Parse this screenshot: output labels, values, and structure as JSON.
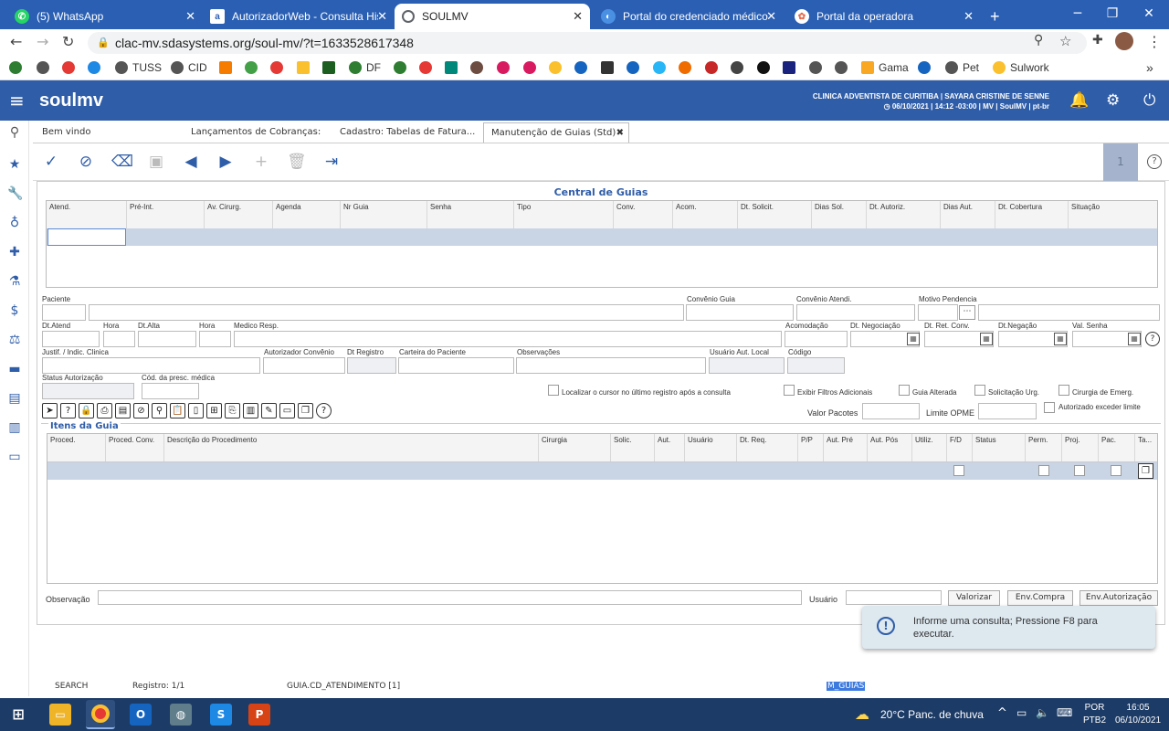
{
  "browser": {
    "tabs": [
      {
        "title": "(5) WhatsApp",
        "icon": "whatsapp-icon",
        "color": "#25d366"
      },
      {
        "title": "AutorizadorWeb - Consulta Histó",
        "icon": "autorizador-icon",
        "color": "#ffffff"
      },
      {
        "title": "SOULMV",
        "icon": "globe-icon",
        "color": "#5f6368",
        "active": true
      },
      {
        "title": "Portal do credenciado médico",
        "icon": "portal-icon",
        "color": "#4a90e2"
      },
      {
        "title": "Portal da operadora",
        "icon": "operadora-icon",
        "color": "#e56a4c"
      }
    ],
    "url": "clac-mv.sdasystems.org/soul-mv/?t=1633528617348",
    "bookmarks": [
      "TUSS",
      "CID",
      "DF",
      "Gama",
      "Pet",
      "Sulwork"
    ]
  },
  "app": {
    "logo": "soulmv",
    "user_line1": "CLINICA ADVENTISTA DE CURITIBA | SAYARA CRISTINE DE SENNE",
    "user_line2": "06/10/2021 | 14:12 -03:00 | MV | SoulMV | pt-br",
    "tabs": [
      {
        "label": "Bem vindo"
      },
      {
        "label": "Lançamentos de Cobranças: ..."
      },
      {
        "label": "Cadastro: Tabelas de Fatura..."
      },
      {
        "label": "Manutenção de Guias (Std)",
        "active": true
      }
    ],
    "record_counter": "1"
  },
  "form": {
    "section_title": "Central de Guias",
    "guide_columns": [
      "Atend.",
      "Pré-Int.",
      "Av. Cirurg.",
      "Agenda",
      "Nr Guia",
      "Senha",
      "Tipo",
      "Conv.",
      "Acom.",
      "Dt. Solicit.",
      "Dias Sol.",
      "Dt. Autoriz.",
      "Dias Aut.",
      "Dt. Cobertura",
      "Situação"
    ],
    "labels": {
      "paciente": "Paciente",
      "convenio_guia": "Convênio Guia",
      "convenio_atendi": "Convênio Atendi.",
      "motivo_pendencia": "Motivo Pendencia",
      "dt_atend": "Dt.Atend",
      "hora1": "Hora",
      "dt_alta": "Dt.Alta",
      "hora2": "Hora",
      "medico_resp": "Medico Resp.",
      "acomodacao": "Acomodação",
      "dt_negociacao": "Dt. Negociação",
      "dt_ret_conv": "Dt. Ret. Conv.",
      "dt_negacao": "Dt.Negação",
      "val_senha": "Val. Senha",
      "justif": "Justif. / Indic. Clinica",
      "autorizador_convenio": "Autorizador Convênio",
      "dt_registro": "Dt Registro",
      "carteira": "Carteira do Paciente",
      "observacoes": "Observações",
      "usuario_aut_local": "Usuário Aut. Local",
      "codigo": "Código",
      "status_autorizacao": "Status Autorização",
      "cod_presc": "Cód. da presc. médica",
      "localizar_cursor": "Localizar o cursor no último registro após a consulta",
      "exibir_filtros": "Exibir Filtros Adicionais",
      "guia_alterada": "Guia Alterada",
      "solicitacao_urg": "Solicitação Urg.",
      "cirurgia_emerg": "Cirurgia de Emerg.",
      "autorizado_exceder": "Autorizado exceder limite",
      "valor_pacotes": "Valor Pacotes",
      "limite_opme": "Limite OPME",
      "itens_da_guia": "Itens da Guia",
      "observacao": "Observação",
      "usuario": "Usuário"
    },
    "item_columns": [
      "Proced.",
      "Proced. Conv.",
      "Descrição do Procedimento",
      "Cirurgia",
      "Solic.",
      "Aut.",
      "Usuário",
      "Dt. Req.",
      "P/P",
      "Aut. Pré",
      "Aut. Pós",
      "Utiliz.",
      "F/D",
      "Status",
      "Perm.",
      "Proj.",
      "Pac.",
      "Ta..."
    ],
    "buttons": {
      "valorizar": "Valorizar",
      "env_compra": "Env.Compra",
      "env_autorizacao": "Env.Autorização"
    }
  },
  "toast": {
    "message": "Informe uma consulta; Pressione F8 para executar."
  },
  "status_bar": {
    "mode": "SEARCH",
    "registro": "Registro: 1/1",
    "field": "GUIA.CD_ATENDIMENTO [1]",
    "block": "M_GUIAS"
  },
  "taskbar": {
    "weather": "20°C  Panc. de chuva",
    "lang1": "POR",
    "lang2": "PTB2",
    "time": "16:05",
    "date": "06/10/2021"
  }
}
